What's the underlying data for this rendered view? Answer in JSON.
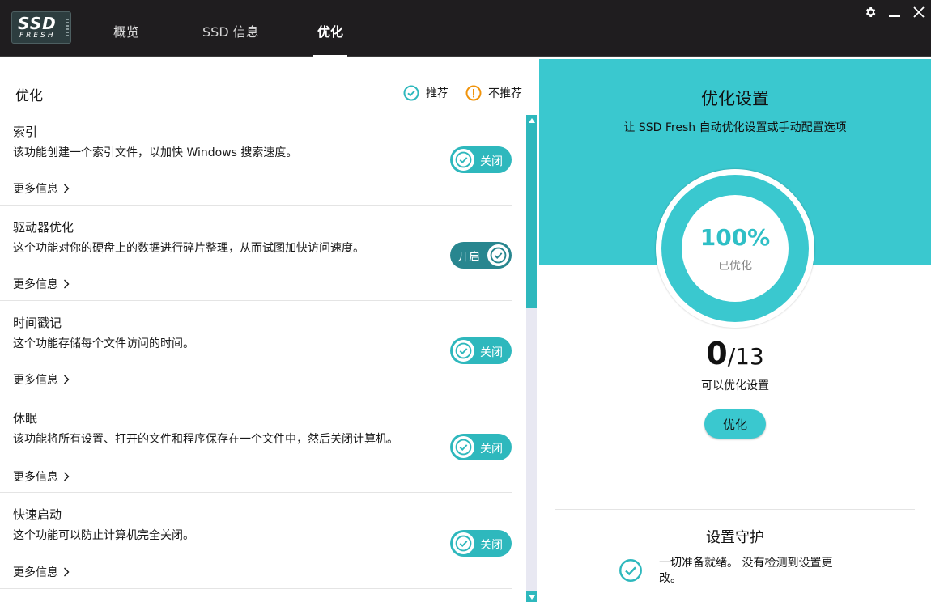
{
  "app": {
    "logo_top": "SSD",
    "logo_bottom": "FRESH"
  },
  "nav": {
    "tabs": [
      {
        "label": "概览"
      },
      {
        "label": "SSD 信息"
      },
      {
        "label": "优化",
        "active": true
      }
    ]
  },
  "window_controls": {
    "settings_icon": "gear-icon",
    "minimize_icon": "minimize-icon",
    "close_icon": "close-icon"
  },
  "left_panel": {
    "title": "优化",
    "legend": {
      "recommended": "推荐",
      "not_recommended": "不推荐"
    },
    "more_label": "更多信息",
    "items": [
      {
        "title": "索引",
        "desc": "该功能创建一个索引文件，以加快 Windows 搜索速度。",
        "toggle": "关闭",
        "state": "off"
      },
      {
        "title": "驱动器优化",
        "desc": "这个功能对你的硬盘上的数据进行碎片整理，从而试图加快访问速度。",
        "toggle": "开启",
        "state": "on"
      },
      {
        "title": "时间戳记",
        "desc": "这个功能存储每个文件访问的时间。",
        "toggle": "关闭",
        "state": "off"
      },
      {
        "title": "休眠",
        "desc": "该功能将所有设置、打开的文件和程序保存在一个文件中，然后关闭计算机。",
        "toggle": "关闭",
        "state": "off"
      },
      {
        "title": "快速启动",
        "desc": "这个功能可以防止计算机完全关闭。",
        "toggle": "关闭",
        "state": "off"
      }
    ]
  },
  "right_panel": {
    "title": "优化设置",
    "subtitle": "让 SSD Fresh 自动优化设置或手动配置选项",
    "progress_percent": 100,
    "percent_text": "100%",
    "percent_label": "已优化",
    "count_value": "0",
    "count_total": "/13",
    "count_label": "可以优化设置",
    "optimize_button": "优化",
    "guard_title": "设置守护",
    "guard_text": "一切准备就绪。 没有检测到设置更改。"
  },
  "colors": {
    "accent": "#3ac8cf",
    "toggle": "#2eb8bd",
    "toggle_on": "#28868f",
    "warning": "#f0930a",
    "topbar": "#1f1d1f"
  }
}
